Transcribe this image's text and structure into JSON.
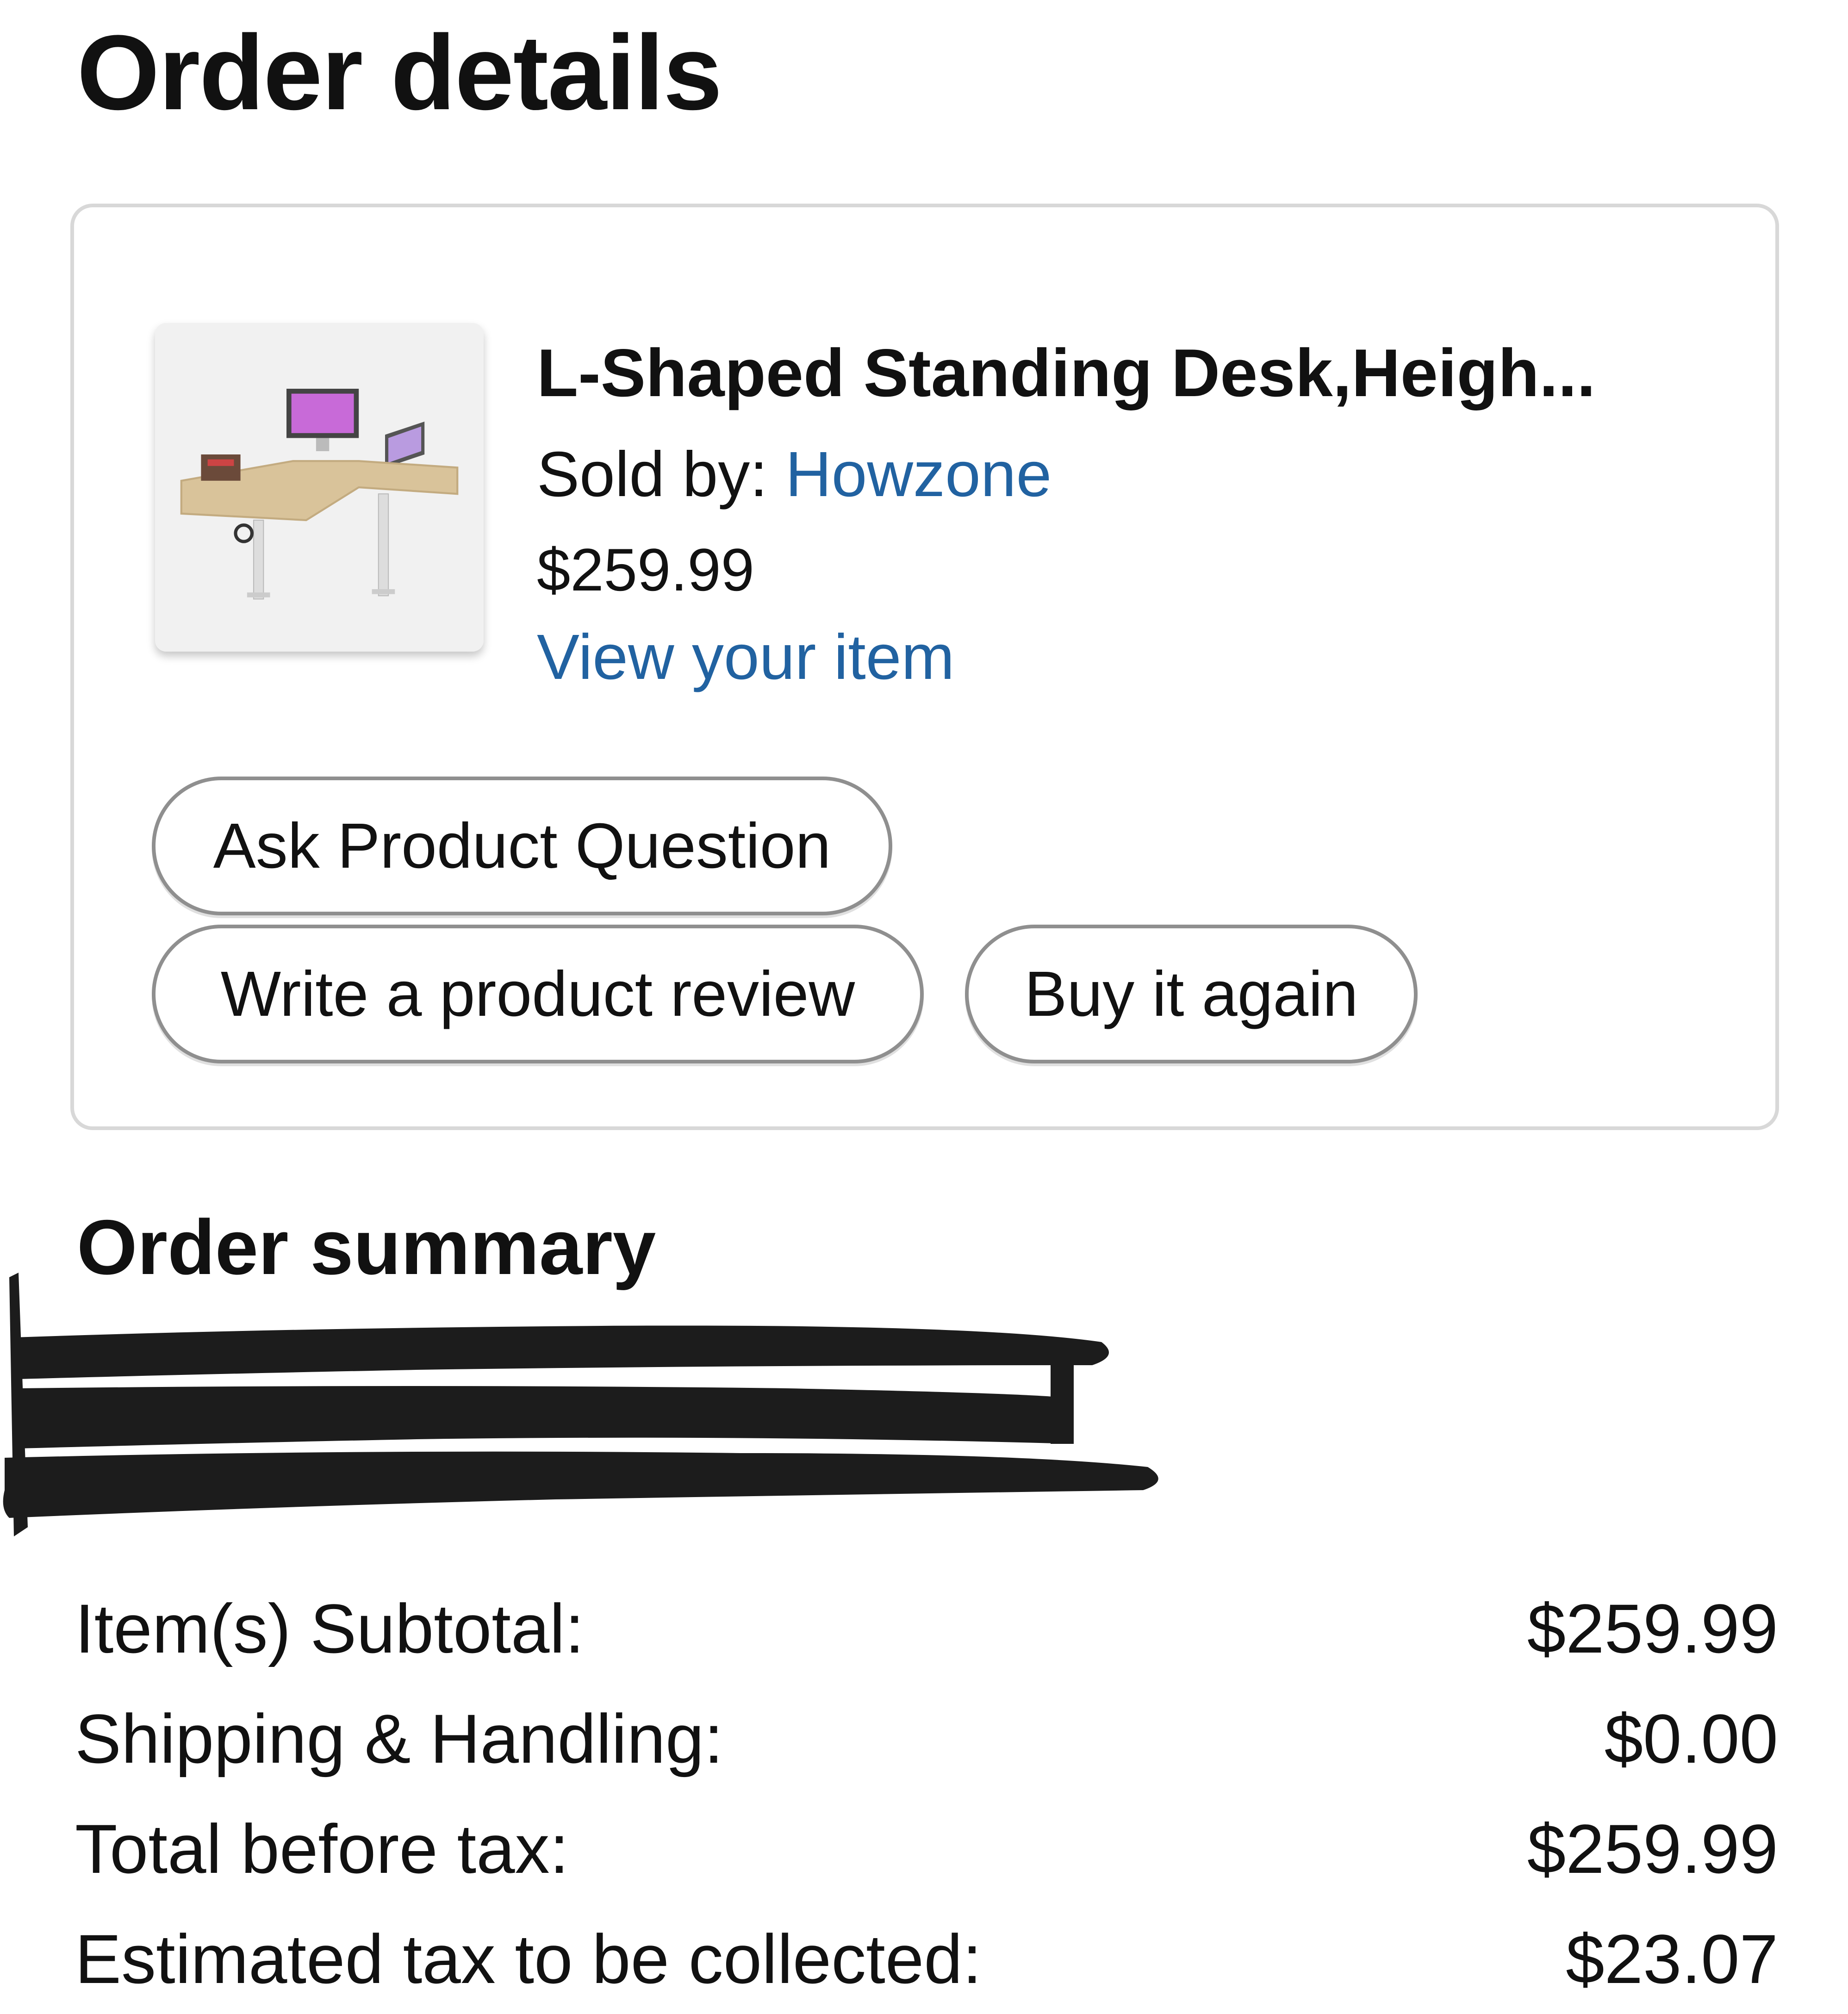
{
  "page": {
    "title": "Order details"
  },
  "order_item": {
    "title": "L-Shaped Standing Desk,Heigh...",
    "sold_by_label": "Sold by: ",
    "seller": "Howzone",
    "price": "$259.99",
    "view_item_link": "View your item",
    "image_icon": "product-desk-image"
  },
  "actions": {
    "ask_question": "Ask Product Question",
    "write_review": "Write a product review",
    "buy_again": "Buy it again"
  },
  "summary": {
    "title": "Order summary",
    "rows": [
      {
        "label": "Item(s) Subtotal:",
        "value": "$259.99"
      },
      {
        "label": "Shipping & Handling:",
        "value": "$0.00"
      },
      {
        "label": "Total before tax:",
        "value": "$259.99"
      },
      {
        "label": "Estimated tax to be collected:",
        "value": "$23.07"
      }
    ]
  },
  "colors": {
    "link": "#2162a1",
    "text": "#111111",
    "border": "#d8d8d8",
    "redaction": "#1c1c1c"
  }
}
